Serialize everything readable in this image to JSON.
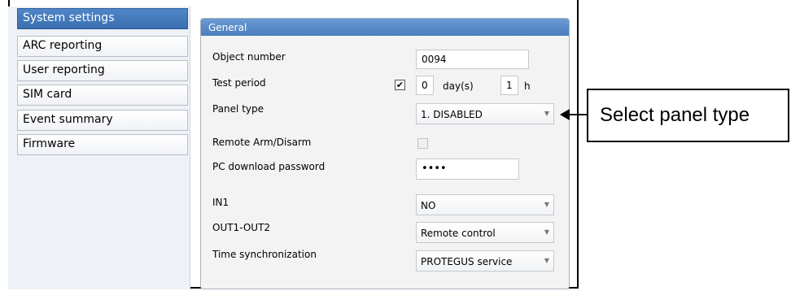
{
  "sidebar": {
    "items": [
      {
        "label": "System settings",
        "active": true
      },
      {
        "label": "ARC reporting",
        "active": false
      },
      {
        "label": "User reporting",
        "active": false
      },
      {
        "label": "SIM card",
        "active": false
      },
      {
        "label": "Event summary",
        "active": false
      },
      {
        "label": "Firmware",
        "active": false
      }
    ]
  },
  "panel": {
    "title": "General",
    "object_number": {
      "label": "Object number",
      "value": "0094"
    },
    "test_period": {
      "label": "Test period",
      "checked": true,
      "days": "0",
      "days_unit": "day(s)",
      "hours": "1",
      "hours_unit": "h"
    },
    "panel_type": {
      "label": "Panel type",
      "value": "1. DISABLED"
    },
    "remote_arm": {
      "label": "Remote Arm/Disarm",
      "checked": false
    },
    "pc_password": {
      "label": "PC download password",
      "value": "••••"
    },
    "in1": {
      "label": "IN1",
      "value": "NO"
    },
    "out1_out2": {
      "label": "OUT1-OUT2",
      "value": "Remote control"
    },
    "time_sync": {
      "label": "Time synchronization",
      "value": "PROTEGUS service"
    }
  },
  "callout": {
    "text": "Select panel type"
  },
  "icons": {
    "dropdown": "chevron-down-icon",
    "check": "checkmark-icon",
    "arrow": "arrow-left-icon"
  },
  "colors": {
    "accent": "#4a7cbf",
    "sidebar_bg": "#eef1f6",
    "panel_bg": "#f3f3f3"
  }
}
